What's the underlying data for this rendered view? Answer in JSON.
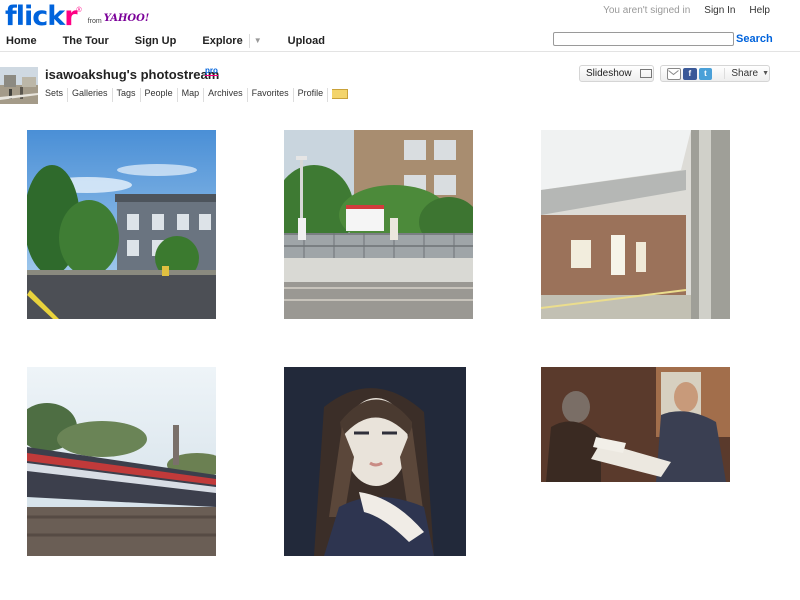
{
  "brand": {
    "logo_b": "flick",
    "logo_p": "r",
    "reg": "®",
    "from": "from",
    "yahoo": "YAHOO!"
  },
  "topbar": {
    "status": "You aren't signed in",
    "sign_in": "Sign In",
    "help": "Help"
  },
  "nav": {
    "items": [
      "Home",
      "The Tour",
      "Sign Up",
      "Explore",
      "Upload"
    ],
    "explore_caret": "▼"
  },
  "search": {
    "value": "",
    "placeholder": "",
    "button": "Search"
  },
  "stream": {
    "title": "isawoakshug's photostream",
    "pro": "pro",
    "subnav": [
      "Sets",
      "Galleries",
      "Tags",
      "People",
      "Map",
      "Archives",
      "Favorites",
      "Profile"
    ],
    "slideshow": "Slideshow",
    "share": "Share",
    "share_caret": "▼",
    "fb": "f",
    "tw": "t"
  },
  "photos": [
    {
      "subject": "victorian-houses-street"
    },
    {
      "subject": "train-platform-station"
    },
    {
      "subject": "train-window-view"
    },
    {
      "subject": "moving-train-blur"
    },
    {
      "subject": "painted-portrait-woman"
    },
    {
      "subject": "painted-people-reading"
    }
  ],
  "colors": {
    "brand_blue": "#0063dc",
    "brand_pink": "#ff0084",
    "yahoo_purple": "#7b0099"
  },
  "icons": [
    "envelope-icon",
    "monitor-icon",
    "facebook-icon",
    "twitter-icon",
    "chevron-down-icon"
  ]
}
